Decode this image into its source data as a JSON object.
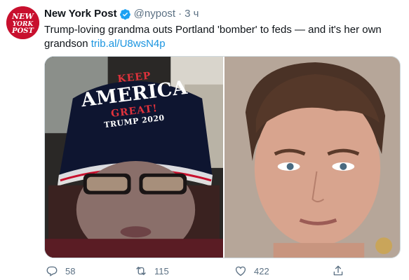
{
  "account": {
    "logo_text": "NEW YORK POST",
    "name": "New York Post",
    "handle": "@nypost",
    "separator": "·",
    "time": "3 ч"
  },
  "tweet": {
    "text": "Trump-loving grandma outs Portland 'bomber' to feds — and it's her own grandson",
    "link": "trib.al/U8wsN4p"
  },
  "media": {
    "left_photo_hat": {
      "keep": "KEEP",
      "america": "AMERICA",
      "great": "GREAT!",
      "trump": "TRUMP 2020"
    }
  },
  "actions": {
    "reply_count": "58",
    "retweet_count": "115",
    "like_count": "422"
  },
  "colors": {
    "brand_red": "#c8102e",
    "link_blue": "#1b95e0",
    "muted": "#5b7083",
    "verified_blue": "#1da1f2"
  },
  "icons": [
    "nypost-logo",
    "verified-badge-icon",
    "reply-icon",
    "retweet-icon",
    "like-icon",
    "share-icon"
  ]
}
